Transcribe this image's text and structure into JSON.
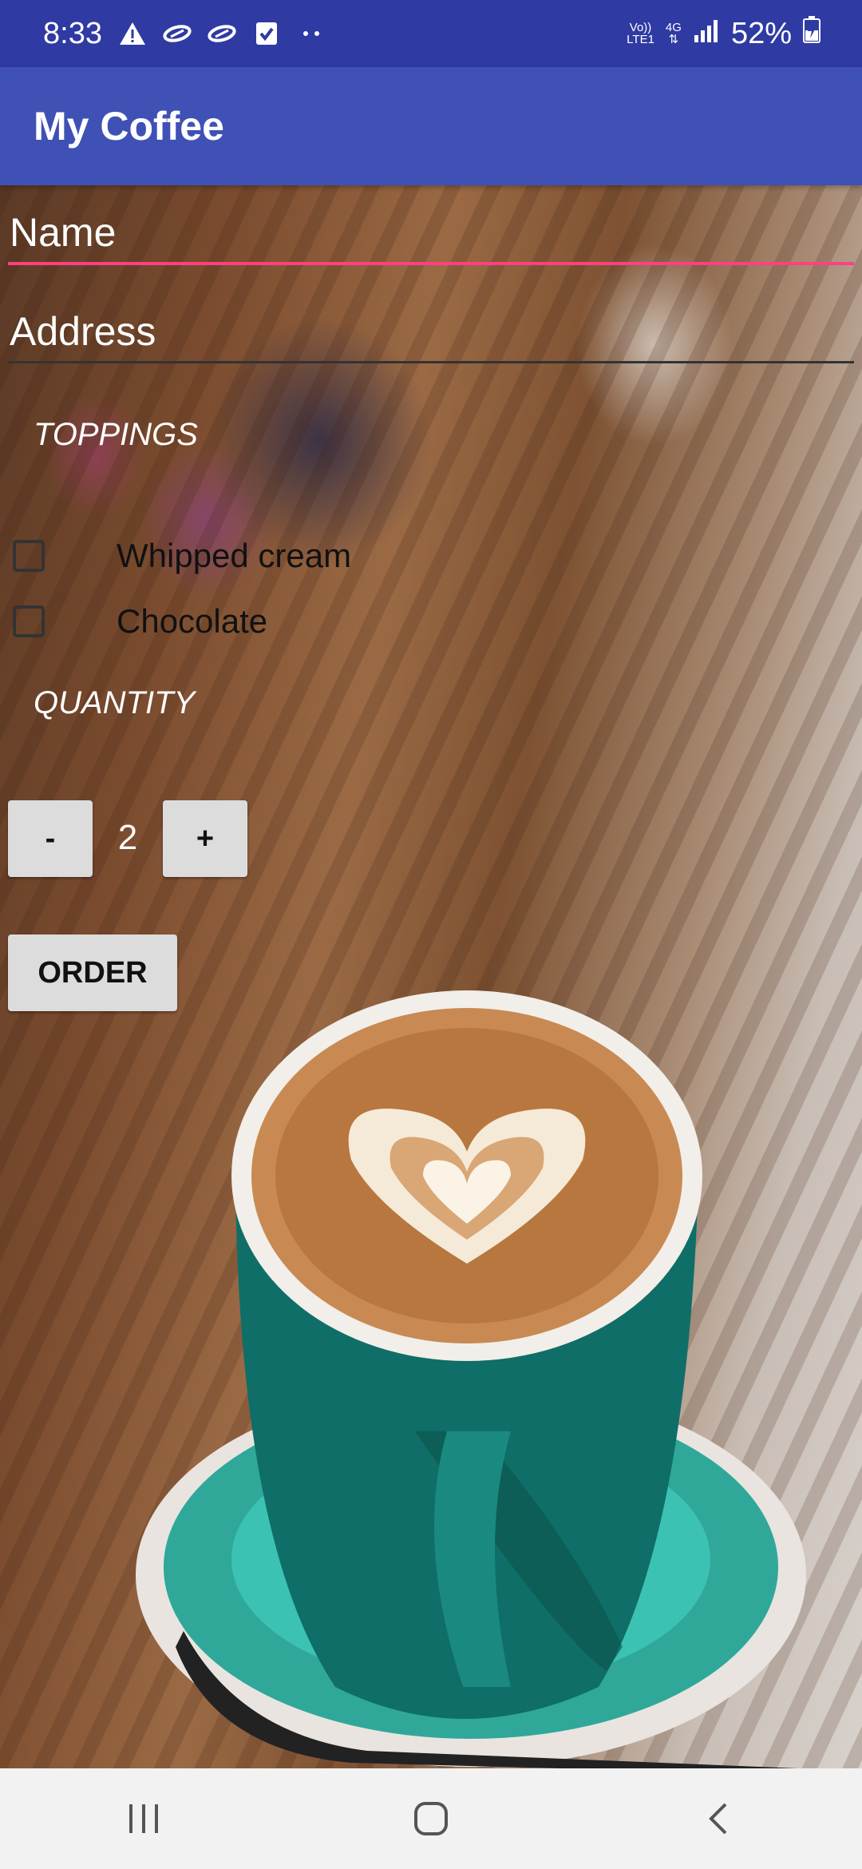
{
  "status_bar": {
    "time": "8:33",
    "notification_icons": [
      "warning-icon",
      "link-icon",
      "link-icon",
      "checkbox-icon",
      "more-dots-icon"
    ],
    "volte_label": "Vo))",
    "lte_label": "LTE1",
    "network_label": "4G",
    "battery_percent": "52%"
  },
  "app_bar": {
    "title": "My Coffee"
  },
  "form": {
    "name_placeholder": "Name",
    "address_placeholder": "Address",
    "toppings_label": "TOPPINGS",
    "toppings": [
      {
        "label": "Whipped cream",
        "checked": false
      },
      {
        "label": "Chocolate",
        "checked": false
      }
    ],
    "quantity_label": "QUANTITY",
    "decrement_label": "-",
    "quantity_value": "2",
    "increment_label": "+",
    "order_label": "ORDER"
  },
  "colors": {
    "status_bar": "#2f3aa3",
    "app_bar": "#3f51b5",
    "accent": "#ff4081",
    "button": "#dcdcdc"
  },
  "nav_bar": {
    "buttons": [
      "recent-apps-icon",
      "home-icon",
      "back-icon"
    ]
  }
}
